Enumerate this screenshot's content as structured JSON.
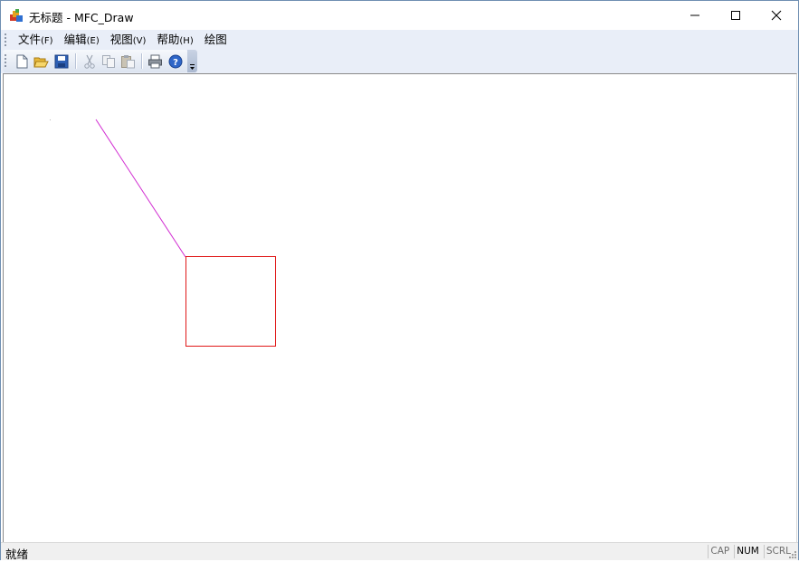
{
  "window": {
    "title": "无标题 - MFC_Draw"
  },
  "menu": {
    "items": [
      {
        "label": "文件",
        "accel": "(F)"
      },
      {
        "label": "编辑",
        "accel": "(E)"
      },
      {
        "label": "视图",
        "accel": "(V)"
      },
      {
        "label": "帮助",
        "accel": "(H)"
      },
      {
        "label": "绘图",
        "accel": ""
      }
    ]
  },
  "toolbar": {
    "buttons": [
      "new-icon",
      "open-icon",
      "save-icon",
      "cut-icon",
      "copy-icon",
      "paste-icon",
      "print-icon",
      "help-icon"
    ]
  },
  "canvas": {
    "line_color": "#d12bd1",
    "rect_color": "#e01818"
  },
  "status": {
    "text": "就绪",
    "indicators": [
      {
        "label": "CAP",
        "active": false
      },
      {
        "label": "NUM",
        "active": true
      },
      {
        "label": "SCRL",
        "active": false
      }
    ]
  }
}
